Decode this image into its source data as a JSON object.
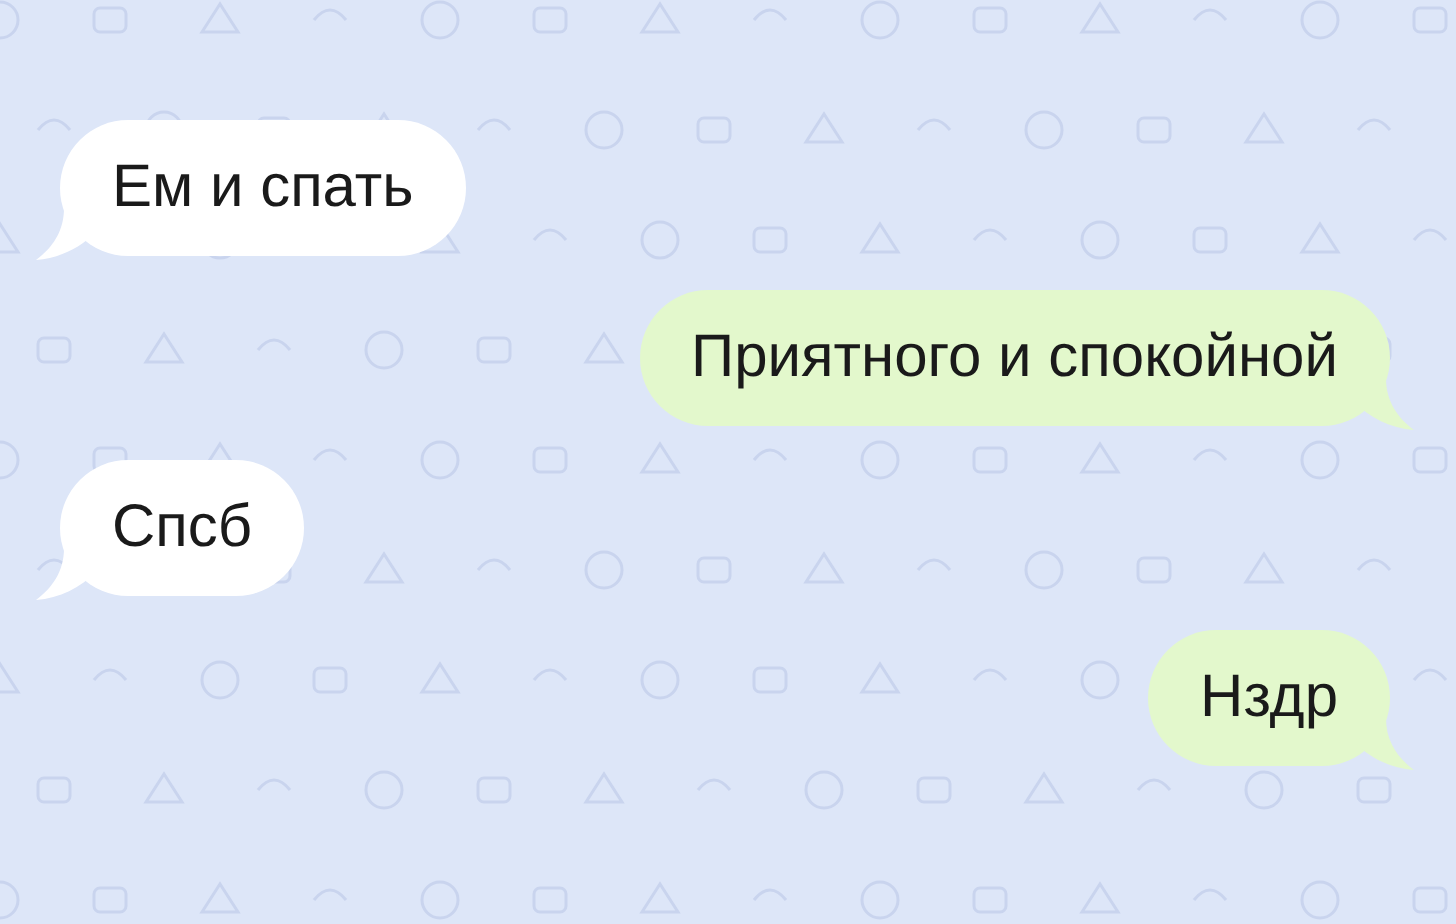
{
  "messages": [
    {
      "kind": "incoming",
      "text": "Ем и спать"
    },
    {
      "kind": "outgoing",
      "text": "Приятного и спокойной"
    },
    {
      "kind": "incoming",
      "text": "Спсб"
    },
    {
      "kind": "outgoing",
      "text": "Нздр"
    }
  ]
}
